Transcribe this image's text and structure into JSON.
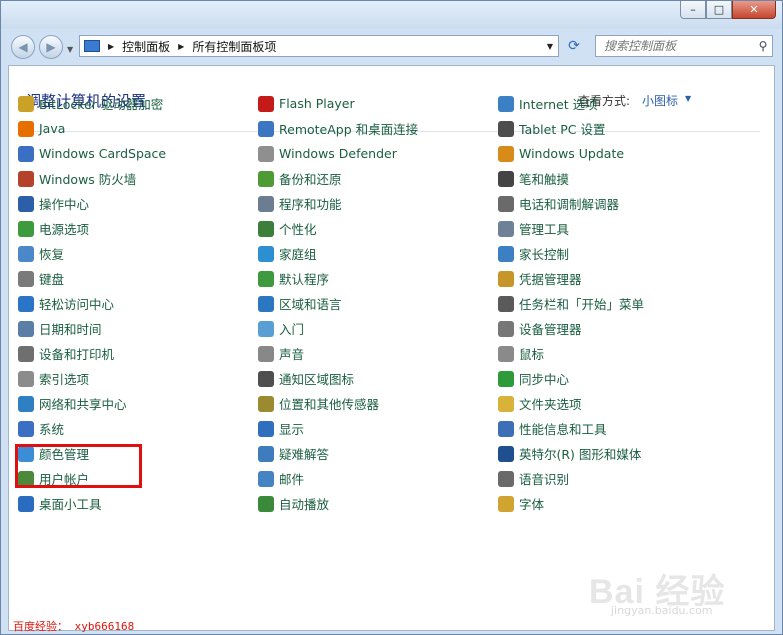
{
  "window": {
    "buttons": {
      "minimize": "–",
      "maximize": "□",
      "close": "✕"
    }
  },
  "nav": {
    "breadcrumb": [
      "控制面板",
      "所有控制面板项"
    ],
    "search_placeholder": "搜索控制面板"
  },
  "header": {
    "title": "调整计算机的设置",
    "view_label": "查看方式:",
    "view_value": "小图标"
  },
  "items": {
    "col1": [
      {
        "label": "BitLocker 驱动器加密",
        "icon": "bitlocker-icon",
        "color": "#c9a227"
      },
      {
        "label": "Java",
        "icon": "java-icon",
        "color": "#e76f00"
      },
      {
        "label": "Windows CardSpace",
        "icon": "cardspace-icon",
        "color": "#3a6fc4"
      },
      {
        "label": "Windows 防火墙",
        "icon": "firewall-icon",
        "color": "#b5432c"
      },
      {
        "label": "操作中心",
        "icon": "action-center-flag-icon",
        "color": "#2c5fa8"
      },
      {
        "label": "电源选项",
        "icon": "power-icon",
        "color": "#3d9a3d"
      },
      {
        "label": "恢复",
        "icon": "recovery-icon",
        "color": "#4a88c9"
      },
      {
        "label": "键盘",
        "icon": "keyboard-icon",
        "color": "#7a7a7a"
      },
      {
        "label": "轻松访问中心",
        "icon": "ease-of-access-icon",
        "color": "#2b74c7"
      },
      {
        "label": "日期和时间",
        "icon": "clock-icon",
        "color": "#5a7ea6"
      },
      {
        "label": "设备和打印机",
        "icon": "printer-icon",
        "color": "#6f6f6f"
      },
      {
        "label": "索引选项",
        "icon": "magnifier-icon",
        "color": "#8c8c8c"
      },
      {
        "label": "网络和共享中心",
        "icon": "network-icon",
        "color": "#2f7fc3"
      },
      {
        "label": "系统",
        "icon": "system-icon",
        "color": "#3a6fc4"
      },
      {
        "label": "颜色管理",
        "icon": "color-management-icon",
        "color": "#3b8ed6"
      },
      {
        "label": "用户帐户",
        "icon": "user-accounts-icon",
        "color": "#4b8a3a"
      },
      {
        "label": "桌面小工具",
        "icon": "gadgets-icon",
        "color": "#2a6cc0"
      }
    ],
    "col2": [
      {
        "label": "Flash Player",
        "icon": "flash-icon",
        "color": "#c41a1a"
      },
      {
        "label": "RemoteApp 和桌面连接",
        "icon": "remoteapp-icon",
        "color": "#3c75c2"
      },
      {
        "label": "Windows Defender",
        "icon": "defender-icon",
        "color": "#8f8f8f"
      },
      {
        "label": "备份和还原",
        "icon": "backup-icon",
        "color": "#4e9a35"
      },
      {
        "label": "程序和功能",
        "icon": "programs-icon",
        "color": "#6b7d91"
      },
      {
        "label": "个性化",
        "icon": "personalization-icon",
        "color": "#3b7f3b"
      },
      {
        "label": "家庭组",
        "icon": "homegroup-icon",
        "color": "#2c8fd1"
      },
      {
        "label": "默认程序",
        "icon": "default-programs-icon",
        "color": "#3f9a3f"
      },
      {
        "label": "区域和语言",
        "icon": "globe-icon",
        "color": "#2c78c0"
      },
      {
        "label": "入门",
        "icon": "getting-started-icon",
        "color": "#5a9fd4"
      },
      {
        "label": "声音",
        "icon": "speaker-icon",
        "color": "#888888"
      },
      {
        "label": "通知区域图标",
        "icon": "notification-icon",
        "color": "#4f4f4f"
      },
      {
        "label": "位置和其他传感器",
        "icon": "sensors-icon",
        "color": "#9a8a30"
      },
      {
        "label": "显示",
        "icon": "display-icon",
        "color": "#2f6fbe"
      },
      {
        "label": "疑难解答",
        "icon": "troubleshooting-icon",
        "color": "#3f7cbd"
      },
      {
        "label": "邮件",
        "icon": "mail-icon",
        "color": "#4583c2"
      },
      {
        "label": "自动播放",
        "icon": "autoplay-icon",
        "color": "#3b8a3b"
      }
    ],
    "col3": [
      {
        "label": "Internet 选项",
        "icon": "internet-options-icon",
        "color": "#3b7fc4"
      },
      {
        "label": "Tablet PC 设置",
        "icon": "tablet-icon",
        "color": "#4d4d4d"
      },
      {
        "label": "Windows Update",
        "icon": "windows-update-icon",
        "color": "#d88a1a"
      },
      {
        "label": "笔和触摸",
        "icon": "pen-icon",
        "color": "#444444"
      },
      {
        "label": "电话和调制解调器",
        "icon": "phone-modem-icon",
        "color": "#6a6a6a"
      },
      {
        "label": "管理工具",
        "icon": "admin-tools-icon",
        "color": "#6f8196"
      },
      {
        "label": "家长控制",
        "icon": "parental-controls-icon",
        "color": "#3c7fc3"
      },
      {
        "label": "凭据管理器",
        "icon": "credential-icon",
        "color": "#c6962b"
      },
      {
        "label": "任务栏和「开始」菜单",
        "icon": "taskbar-icon",
        "color": "#5a5a5a"
      },
      {
        "label": "设备管理器",
        "icon": "device-manager-icon",
        "color": "#777777"
      },
      {
        "label": "鼠标",
        "icon": "mouse-icon",
        "color": "#8a8a8a"
      },
      {
        "label": "同步中心",
        "icon": "sync-icon",
        "color": "#2f9a3a"
      },
      {
        "label": "文件夹选项",
        "icon": "folder-icon",
        "color": "#d9b23a"
      },
      {
        "label": "性能信息和工具",
        "icon": "performance-icon",
        "color": "#3c6fb5"
      },
      {
        "label": "英特尔(R) 图形和媒体",
        "icon": "intel-graphics-icon",
        "color": "#1f4f8f"
      },
      {
        "label": "语音识别",
        "icon": "microphone-icon",
        "color": "#6a6a6a"
      },
      {
        "label": "字体",
        "icon": "fonts-icon",
        "color": "#d1a331"
      }
    ]
  },
  "watermark": {
    "text": "百度经验： xyb666168",
    "logo": "Bai 经验",
    "site": "jingyan.baidu.com"
  }
}
